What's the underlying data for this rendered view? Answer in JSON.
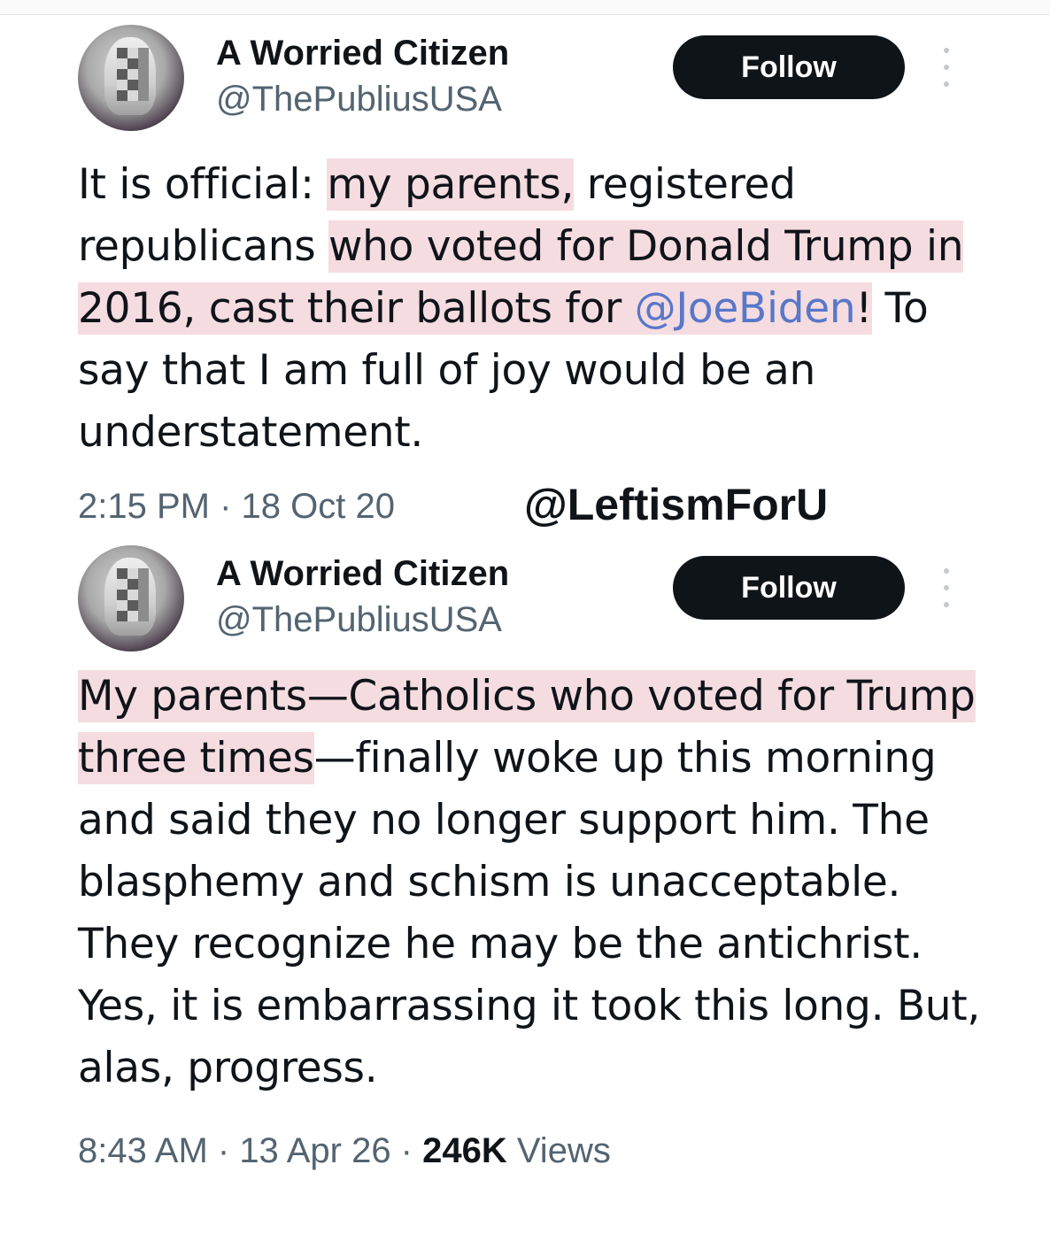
{
  "watermark": "@LeftismForU",
  "tweets": [
    {
      "author_name": "A Worried Citizen",
      "author_handle": "@ThePubliusUSA",
      "follow_label": "Follow",
      "text": {
        "p1": "It is official: ",
        "h1": "my parents,",
        "p2": " registered republicans ",
        "h2": "who voted for Donald Trump in 2016, cast their ballots for ",
        "mention": "@JoeBiden",
        "h3": "!",
        "p3": " To say that I am full of joy would be an understatement."
      },
      "time": "2:15 PM",
      "sep": " · ",
      "date": "18 Oct 20"
    },
    {
      "author_name": "A Worried Citizen",
      "author_handle": "@ThePubliusUSA",
      "follow_label": "Follow",
      "text": {
        "h1": "My parents—Catholics who voted for Trump three times",
        "p1": "—finally woke up this morning and said they no longer support him.  The blasphemy and schism is unacceptable. They recognize he may be the antichrist. Yes, it is embarrassing it took this long. But, alas, progress."
      },
      "time": "8:43 AM",
      "sep": " · ",
      "date": "13 Apr 26",
      "views_count": "246K",
      "views_label": " Views"
    }
  ]
}
